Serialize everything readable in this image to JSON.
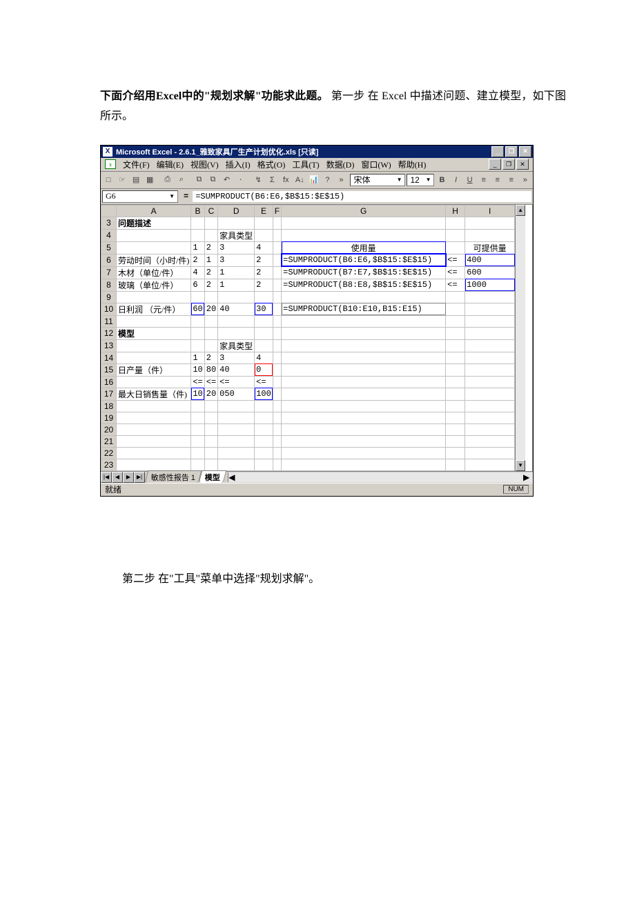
{
  "doc": {
    "intro_bold": "下面介绍用Excel中的\"规划求解\"功能求此题。",
    "intro_rest": " 第一步 在 Excel 中描述问题、建立模型，如下图所示。",
    "second_step": "第二步 在\"工具\"菜单中选择\"规划求解\"。"
  },
  "excel": {
    "title": "Microsoft Excel - 2.6.1_雅致家具厂生产计划优化.xls  [只读]",
    "win_buttons": {
      "min": "_",
      "max": "❐",
      "close": "✕"
    },
    "menu": [
      "文件(F)",
      "编辑(E)",
      "视图(V)",
      "插入(I)",
      "格式(O)",
      "工具(T)",
      "数据(D)",
      "窗口(W)",
      "帮助(H)"
    ],
    "toolbar": {
      "icons": [
        "□",
        "☞",
        "▤",
        "▦",
        "⎙",
        "⌕",
        "⧉",
        "⧉",
        "↶",
        "⋅",
        "↯",
        "Σ",
        "fx",
        "A↓",
        "📊",
        "?",
        "»"
      ],
      "font_name": "宋体",
      "font_size": "12",
      "style": {
        "bold": "B",
        "italic": "I",
        "underline": "U"
      },
      "align": [
        "≡",
        "≡",
        "≡"
      ],
      "more": "»"
    },
    "formula_bar": {
      "cell": "G6",
      "formula": "=SUMPRODUCT(B6:E6,$B$15:$E$15)"
    },
    "columns": [
      "A",
      "B",
      "C",
      "D",
      "E",
      "F",
      "G",
      "H",
      "I"
    ],
    "rows": {
      "3": {
        "A": "问题描述"
      },
      "4": {
        "D": "家具类型"
      },
      "5": {
        "B": "1",
        "C": "2",
        "D": "3",
        "E": "4",
        "G": "使用量",
        "I": "可提供量"
      },
      "6": {
        "A": "劳动时间（小时/件)",
        "B": "2",
        "C": "1",
        "D": "3",
        "E": "2",
        "G": "=SUMPRODUCT(B6:E6,$B$15:$E$15)",
        "H": "<=",
        "I": "400"
      },
      "7": {
        "A": "木材（单位/件）",
        "B": "4",
        "C": "2",
        "D": "1",
        "E": "2",
        "G": "=SUMPRODUCT(B7:E7,$B$15:$E$15)",
        "H": "<=",
        "I": "600"
      },
      "8": {
        "A": "玻璃（单位/件）",
        "B": "6",
        "C": "2",
        "D": "1",
        "E": "2",
        "G": "=SUMPRODUCT(B8:E8,$B$15:$E$15)",
        "H": "<=",
        "I": "1000"
      },
      "10": {
        "A": "日利润 （元/件）",
        "B": "60",
        "C": "20",
        "D": "40",
        "E": "30",
        "G": "=SUMPRODUCT(B10:E10,B15:E15)"
      },
      "12": {
        "A": "模型"
      },
      "13": {
        "D": "家具类型"
      },
      "14": {
        "B": "1",
        "C": "2",
        "D": "3",
        "E": "4"
      },
      "15": {
        "A": "日产量（件）",
        "B": "10",
        "C": "80",
        "D": "40",
        "E": "0"
      },
      "16": {
        "B": "<=",
        "C": "<=",
        "D": "<=",
        "E": "<="
      },
      "17": {
        "A": "最大日销售量（件)",
        "B": "10",
        "C": "20",
        "D": "050",
        "E": "100"
      }
    },
    "tabs": {
      "nav": [
        "|◀",
        "◀",
        "▶",
        "▶|"
      ],
      "sheet1": "敏感性报告 1",
      "sheet2": "模型"
    },
    "status": {
      "ready": "就绪",
      "num": "NUM"
    }
  }
}
